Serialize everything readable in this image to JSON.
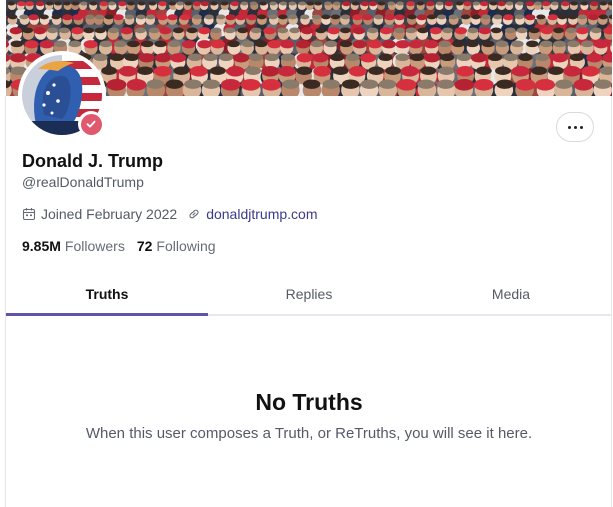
{
  "profile": {
    "display_name": "Donald J. Trump",
    "handle": "@realDonaldTrump",
    "joined": "Joined February 2022",
    "website": "donaldjtrump.com",
    "followers_count": "9.85M",
    "followers_label": "Followers",
    "following_count": "72",
    "following_label": "Following",
    "verified": true
  },
  "tabs": [
    {
      "label": "Truths",
      "active": true
    },
    {
      "label": "Replies",
      "active": false
    },
    {
      "label": "Media",
      "active": false
    }
  ],
  "empty_state": {
    "title": "No Truths",
    "description": "When this user composes a Truth, or ReTruths, you will see it here."
  },
  "icons": {
    "calendar": "calendar-icon",
    "link": "link-icon",
    "more": "more-options-icon",
    "verified": "verified-check-icon"
  },
  "colors": {
    "accent": "#5e55a6",
    "link": "#3b3a8c",
    "verified_badge": "#e05a6f"
  }
}
